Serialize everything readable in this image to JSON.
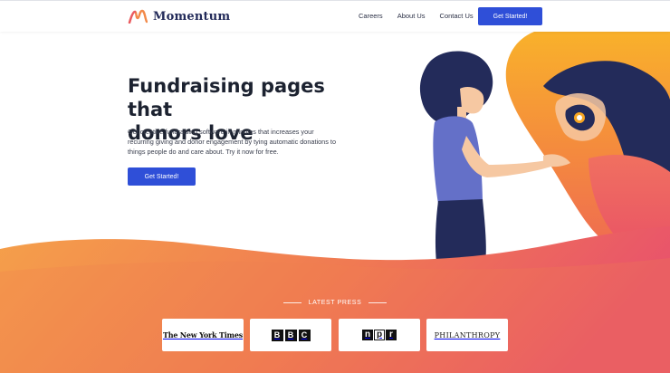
{
  "brand": {
    "name": "Momentum",
    "logo_icon": "momentum-logo-icon"
  },
  "nav": {
    "items": [
      "Careers",
      "About Us",
      "Contact Us"
    ],
    "cta_label": "Get Started!"
  },
  "hero": {
    "title_line1": "Fundraising pages that",
    "title_line2": "donors love",
    "description": "Get creative fundraising software in minutes that increases your recurring giving and donor engagement by tying automatic donations to things people do and care about. Try it now for free.",
    "cta_label": "Get Started!"
  },
  "press": {
    "label": "LATEST PRESS",
    "logos": [
      {
        "name": "The New York Times"
      },
      {
        "name": "BBC",
        "letters": [
          "B",
          "B",
          "C"
        ]
      },
      {
        "name": "npr",
        "letters": [
          "n",
          "p",
          "r"
        ]
      },
      {
        "name": "PHILANTHROPY"
      }
    ]
  },
  "colors": {
    "primary_button": "#2f4fd8",
    "navy": "#232b5a",
    "wave_orange": "#f28a4a",
    "wave_pink": "#ea5a62",
    "swirl_yellow": "#f7a623"
  }
}
